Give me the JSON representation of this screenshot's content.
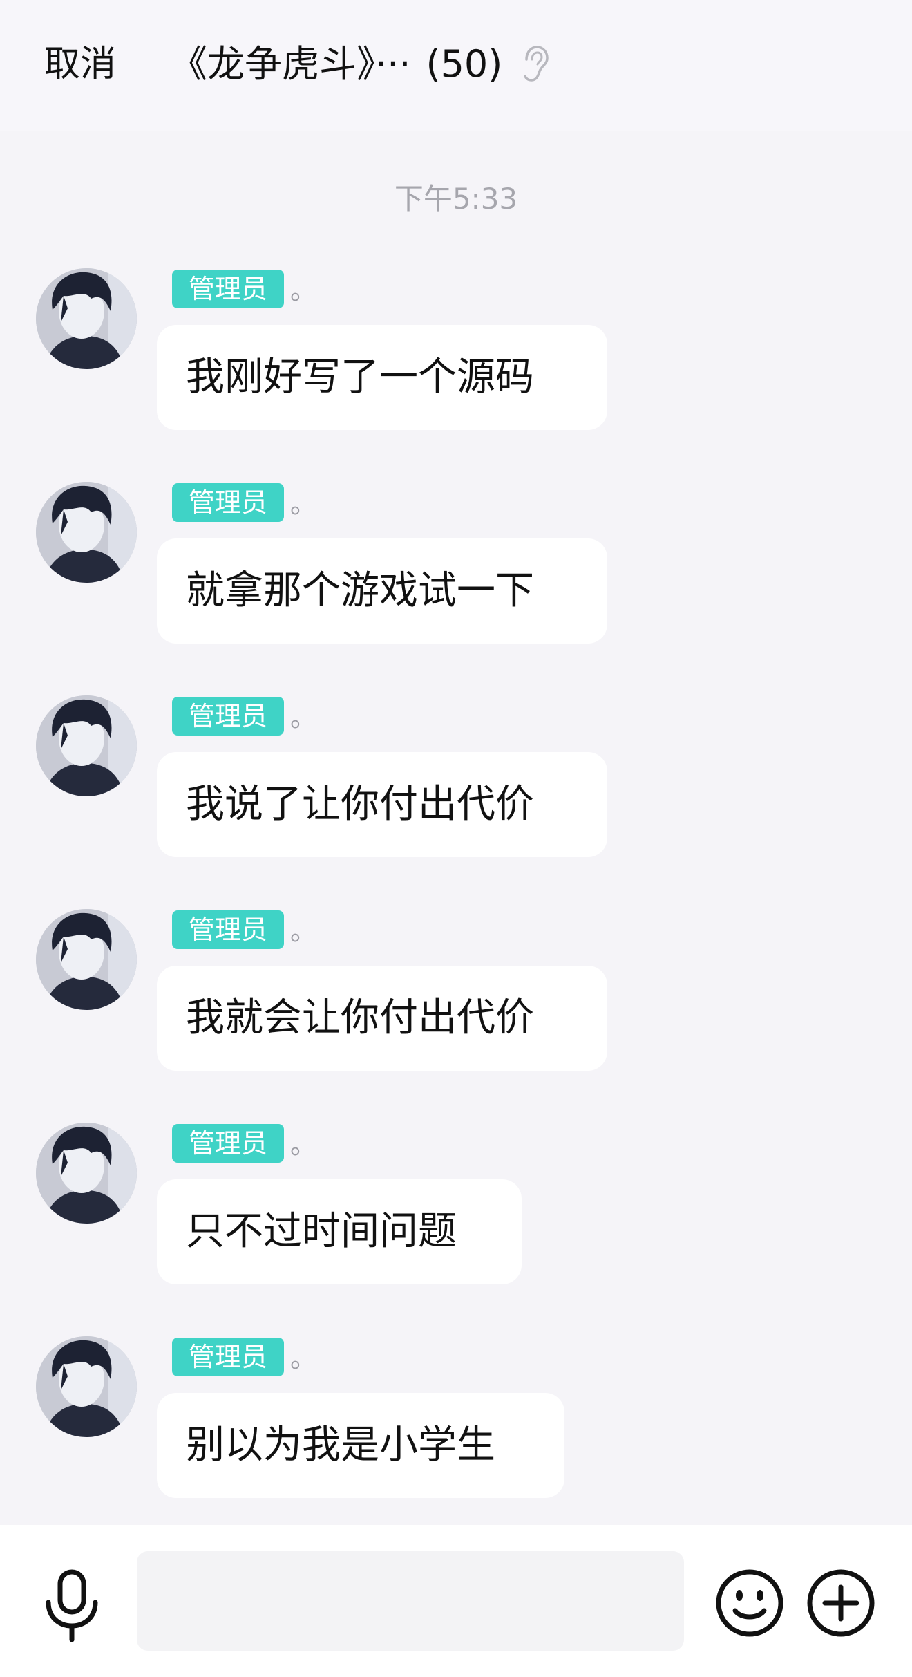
{
  "header": {
    "cancel_label": "取消",
    "title": "《龙争虎斗》···",
    "member_count": "(50)"
  },
  "chat": {
    "timestamp": "下午5:33",
    "messages": [
      {
        "badge": "管理员",
        "nickname": "。",
        "text": "我刚好写了一个源码"
      },
      {
        "badge": "管理员",
        "nickname": "。",
        "text": "就拿那个游戏试一下"
      },
      {
        "badge": "管理员",
        "nickname": "。",
        "text": "我说了让你付出代价"
      },
      {
        "badge": "管理员",
        "nickname": "。",
        "text": "我就会让你付出代价"
      },
      {
        "badge": "管理员",
        "nickname": "。",
        "text": "只不过时间问题"
      },
      {
        "badge": "管理员",
        "nickname": "。",
        "text": "别以为我是小学生"
      }
    ]
  },
  "input_bar": {
    "placeholder": ""
  },
  "icons": {
    "ear": "ear-icon",
    "mic": "mic-icon",
    "emoji": "smiley-icon",
    "plus": "plus-circle-icon"
  },
  "colors": {
    "background": "#f5f4f8",
    "badge_bg": "#3fd3c6",
    "bubble_bg": "#ffffff",
    "timestamp": "#a6a6ad"
  }
}
